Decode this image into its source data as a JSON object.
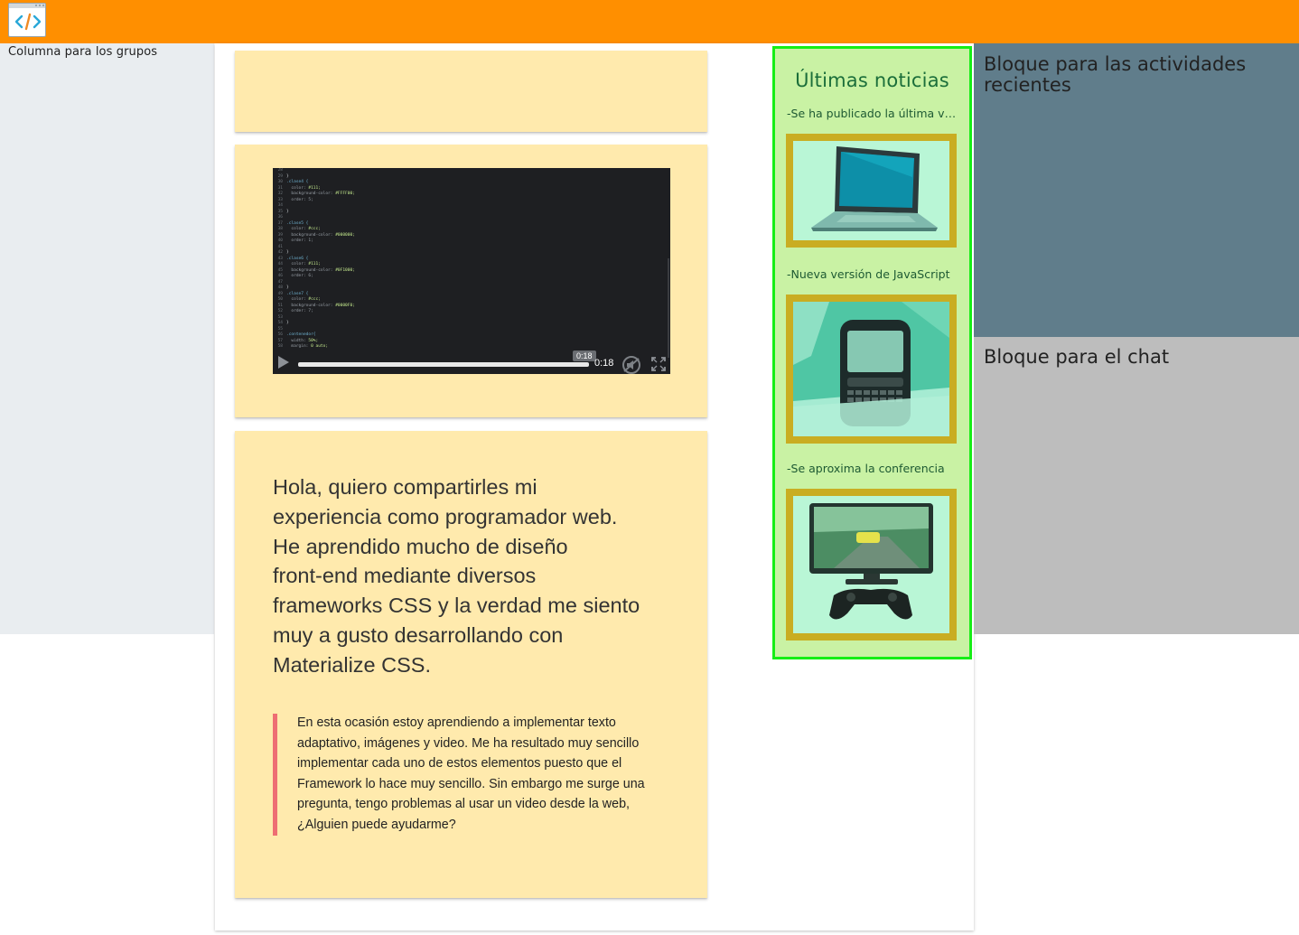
{
  "topbar": {
    "color": "#ff8f00",
    "logo_icon": "code-window-icon"
  },
  "left_column": {
    "title": "Columna para los grupos"
  },
  "video": {
    "current_time": "0:18",
    "bubble_time": "0:18",
    "progress": 1.0,
    "icons": [
      "play-icon",
      "mute-icon",
      "fullscreen-icon"
    ]
  },
  "post": {
    "lines": [
      "Hola, quiero compartirles mi",
      "experiencia como programador web.",
      "He aprendido mucho de diseño",
      "front-end mediante diversos",
      "frameworks CSS y la verdad me siento",
      "muy a gusto desarrollando con",
      "Materialize CSS."
    ],
    "quote_lines": [
      "En esta ocasión estoy aprendiendo a implementar texto",
      "adaptativo, imágenes y video. Me ha resultado muy sencillo",
      "implementar cada uno de estos elementos puesto que el",
      "Framework lo hace muy sencillo. Sin embargo me surge una",
      "pregunta, tengo problemas al usar un video desde la web,",
      "¿Alguien puede ayudarme?"
    ]
  },
  "news": {
    "title": "Últimas noticias",
    "items": [
      {
        "text": "-Se ha publicado la última versión",
        "image": "laptop-image"
      },
      {
        "text": "-Nueva versión de JavaScript",
        "image": "smartphone-image"
      },
      {
        "text": "-Se aproxima la conferencia",
        "image": "gaming-monitor-image"
      }
    ]
  },
  "activity_block": {
    "title_line1": "Bloque para las actividades",
    "title_line2": "recientes"
  },
  "chat_block": {
    "title": "Bloque para el chat"
  }
}
